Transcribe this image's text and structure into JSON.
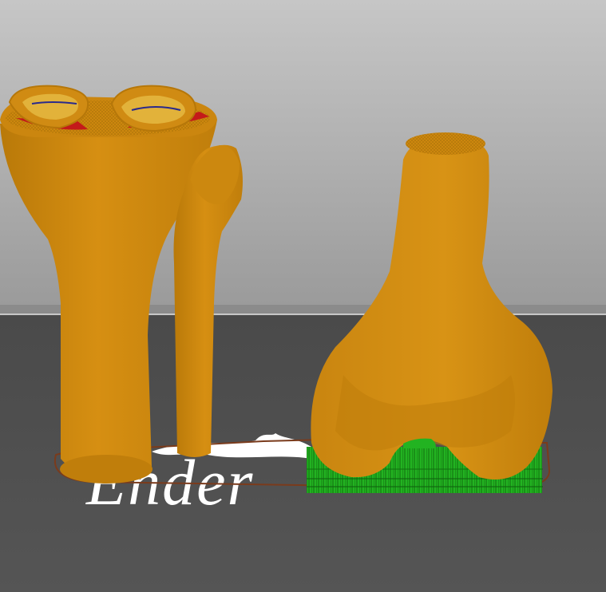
{
  "viewport": {
    "bed_logo_text": "Ender",
    "colors": {
      "background_top": "#c6c6c6",
      "background_bottom": "#9a9a9a",
      "bed_top": "#4a4a4a",
      "bed_bottom": "#555555",
      "bed_edge_line": "#e8e8e8",
      "model_fill": "#d28a0e",
      "model_shadow": "#b77508",
      "model_highlight": "#e09a1b",
      "infill_red": "#c41a1a",
      "infill_blue": "#2a2a8c",
      "support_green": "#22b321",
      "support_dark": "#116d10",
      "skirt_brown": "#7a3b1c",
      "logo_white": "#ffffff"
    },
    "models": [
      {
        "name": "tibia",
        "icon": "tibia-model"
      },
      {
        "name": "fibula",
        "icon": "fibula-model"
      },
      {
        "name": "femur",
        "icon": "femur-model"
      }
    ]
  }
}
